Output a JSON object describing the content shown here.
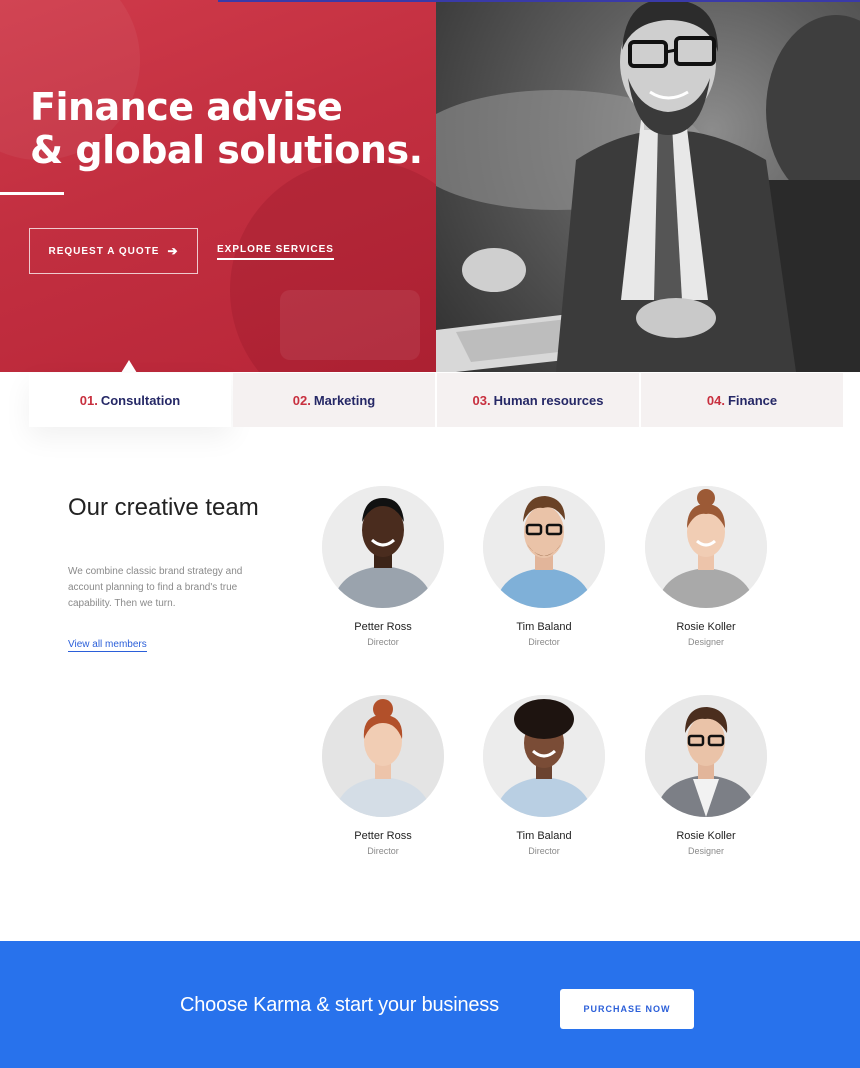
{
  "hero": {
    "title_line1": "Finance advise",
    "title_line2": "& global solutions.",
    "quote_button": "REQUEST A QUOTE",
    "quote_arrow": "➔",
    "explore_link": "EXPLORE SERVICES"
  },
  "tabs": [
    {
      "num": "01.",
      "label": "Consultation"
    },
    {
      "num": "02.",
      "label": "Marketing"
    },
    {
      "num": "03.",
      "label": "Human resources"
    },
    {
      "num": "04.",
      "label": "Finance"
    }
  ],
  "team": {
    "heading": "Our creative team",
    "description": "We combine classic brand strategy and account planning to find a brand's true capability. Then we turn.",
    "link": "View all members",
    "members": [
      {
        "name": "Petter Ross",
        "role": "Director"
      },
      {
        "name": "Tim Baland",
        "role": "Director"
      },
      {
        "name": "Rosie Koller",
        "role": "Designer"
      },
      {
        "name": "Petter Ross",
        "role": "Director"
      },
      {
        "name": "Tim Baland",
        "role": "Director"
      },
      {
        "name": "Rosie Koller",
        "role": "Designer"
      }
    ]
  },
  "cta": {
    "text": "Choose Karma & start your business",
    "button": "PURCHASE NOW"
  },
  "colors": {
    "brand_red": "#c8303f",
    "navy": "#252866",
    "cta_blue": "#2872ec",
    "link_blue": "#2b5fd9"
  }
}
